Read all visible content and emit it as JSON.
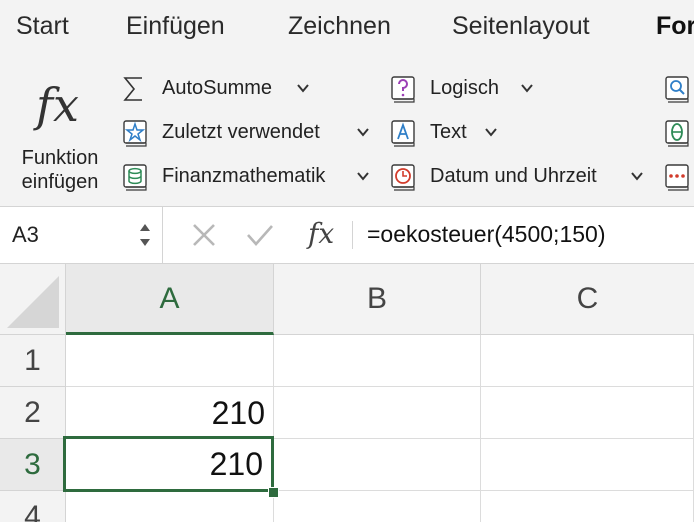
{
  "tabs": [
    "Start",
    "Einfügen",
    "Zeichnen",
    "Seitenlayout",
    "For"
  ],
  "active_tab": "For",
  "ribbon": {
    "insert_function": {
      "icon": "fx-icon",
      "line1": "Funktion",
      "line2": "einfügen"
    },
    "col1": [
      {
        "label": "AutoSumme",
        "icon": "sigma-icon"
      },
      {
        "label": "Zuletzt verwendet",
        "icon": "star-book-icon"
      },
      {
        "label": "Finanzmathematik",
        "icon": "database-book-icon"
      }
    ],
    "col2": [
      {
        "label": "Logisch",
        "icon": "question-book-icon"
      },
      {
        "label": "Text",
        "icon": "letter-a-book-icon"
      },
      {
        "label": "Datum und Uhrzeit",
        "icon": "clock-book-icon"
      }
    ],
    "col3_icons": [
      "search-book-icon",
      "theta-book-icon",
      "dots-book-icon"
    ]
  },
  "formula_bar": {
    "name_box": "A3",
    "fx_symbol": "fx",
    "formula": "=oekosteuer(4500;150)"
  },
  "grid": {
    "columns": [
      "A",
      "B",
      "C"
    ],
    "selected_column": "A",
    "rows": [
      {
        "num": "1",
        "cells": [
          "",
          "",
          ""
        ]
      },
      {
        "num": "2",
        "cells": [
          "210",
          "",
          ""
        ]
      },
      {
        "num": "3",
        "cells": [
          "210",
          "",
          ""
        ]
      },
      {
        "num": "4",
        "cells": [
          "",
          "",
          ""
        ]
      }
    ],
    "active_cell": "A3"
  },
  "colors": {
    "accent_green": "#2e6b3e",
    "ribbon_bg": "#f3f3f3",
    "grid_line": "#dcdcdc"
  }
}
